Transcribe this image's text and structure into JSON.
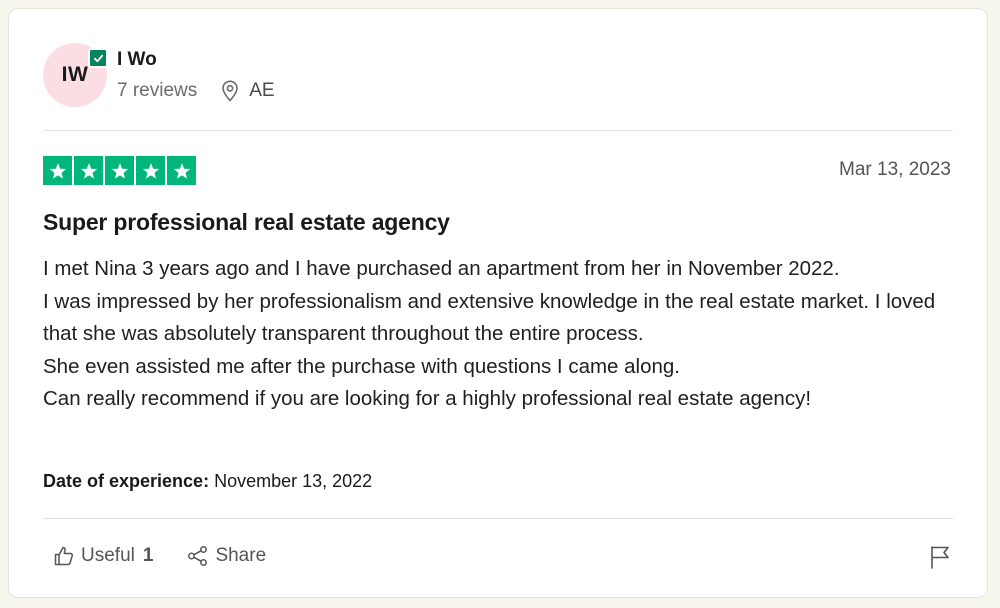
{
  "reviewer": {
    "initials": "IW",
    "name": "I Wo",
    "reviews_count": "7 reviews",
    "country": "AE"
  },
  "review": {
    "rating": 5,
    "date": "Mar 13, 2023",
    "title": "Super professional real estate agency",
    "body_lines": [
      "I met Nina 3 years ago and I have purchased an apartment from her in November 2022.",
      "I was impressed by her professionalism and extensive knowledge in the real estate market. I loved that she was absolutely transparent throughout the entire process.",
      "She even assisted me after the purchase with questions I came along.",
      "Can really recommend if you are looking for a highly professional real estate agency!"
    ],
    "experience_label": "Date of experience:",
    "experience_date": "November 13, 2022"
  },
  "actions": {
    "useful_label": "Useful",
    "useful_count": "1",
    "share_label": "Share"
  },
  "colors": {
    "star_green": "#00b67a",
    "verified_green": "#04845c",
    "avatar_pink": "#fbdde4"
  },
  "icons": {
    "verified": "checkmark-badge-icon",
    "location": "map-pin-icon",
    "star": "star-icon",
    "useful": "thumbs-up-icon",
    "share": "share-icon",
    "flag": "flag-icon"
  }
}
